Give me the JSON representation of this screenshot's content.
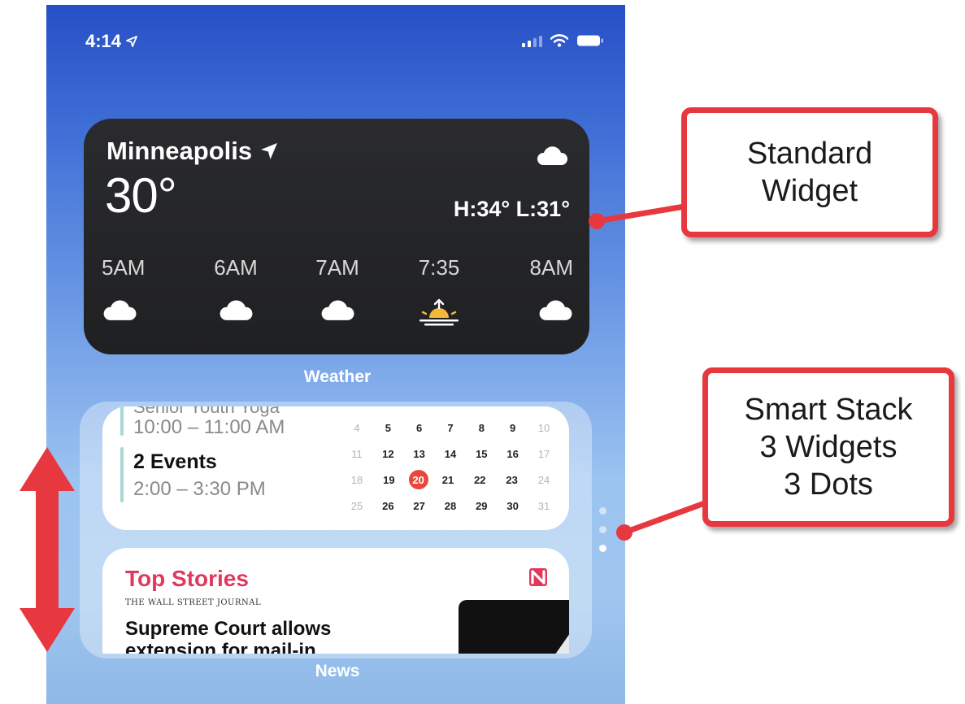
{
  "status_bar": {
    "time": "4:14"
  },
  "weather": {
    "city": "Minneapolis",
    "temperature": "30°",
    "high_low": "H:34° L:31°",
    "hours": [
      {
        "label": "5AM",
        "icon": "cloud-icon"
      },
      {
        "label": "6AM",
        "icon": "cloud-icon"
      },
      {
        "label": "7AM",
        "icon": "cloud-icon"
      },
      {
        "label": "7:35",
        "icon": "sunrise-icon"
      },
      {
        "label": "8AM",
        "icon": "cloud-icon"
      }
    ],
    "caption": "Weather"
  },
  "calendar": {
    "clipped_text": "Senior Youth Yoga",
    "time1": "10:00 – 11:00 AM",
    "events": "2 Events",
    "time2": "2:00 – 3:30 PM",
    "grid": [
      [
        "4",
        "5",
        "6",
        "7",
        "8",
        "9",
        "10"
      ],
      [
        "11",
        "12",
        "13",
        "14",
        "15",
        "16",
        "17"
      ],
      [
        "18",
        "19",
        "20",
        "21",
        "22",
        "23",
        "24"
      ],
      [
        "25",
        "26",
        "27",
        "28",
        "29",
        "30",
        "31"
      ]
    ],
    "today": "20",
    "today_color": "#e8483b"
  },
  "news": {
    "title": "Top Stories",
    "source": "THE WALL STREET JOURNAL",
    "headline": "Supreme Court allows extension for mail-in",
    "caption": "News",
    "title_color": "#e0395b"
  },
  "annotations": {
    "standard_widget": [
      "Standard",
      "Widget"
    ],
    "smart_stack": [
      "Smart Stack",
      "3 Widgets",
      "3 Dots"
    ],
    "accent": "#e8383f"
  }
}
